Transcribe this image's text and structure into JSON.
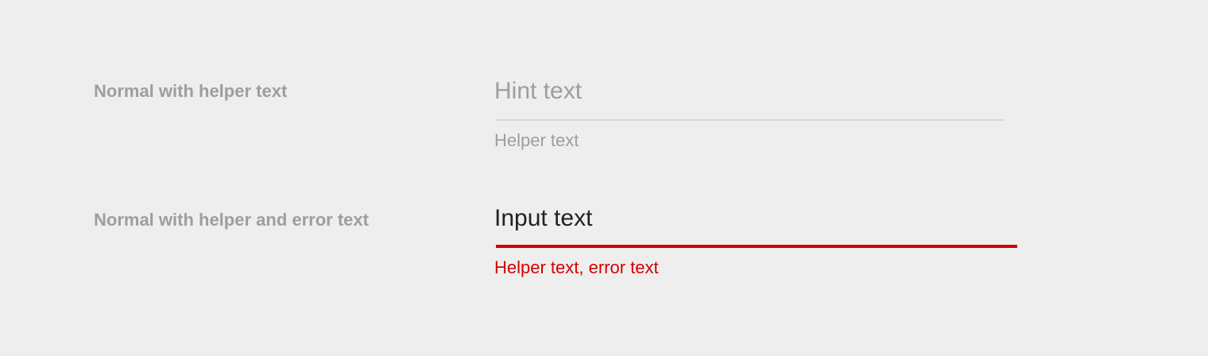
{
  "rows": [
    {
      "label": "Normal with helper text",
      "value": "Hint text",
      "helper": "Helper text"
    },
    {
      "label": "Normal with helper and error text",
      "value": "Input text",
      "helper": "Helper text, error text"
    }
  ],
  "colors": {
    "background": "#eeeeee",
    "label": "#9e9e9e",
    "hint": "#9e9e9e",
    "input_text": "#212121",
    "underline_normal": "#d6d6d6",
    "error": "#d50000"
  }
}
